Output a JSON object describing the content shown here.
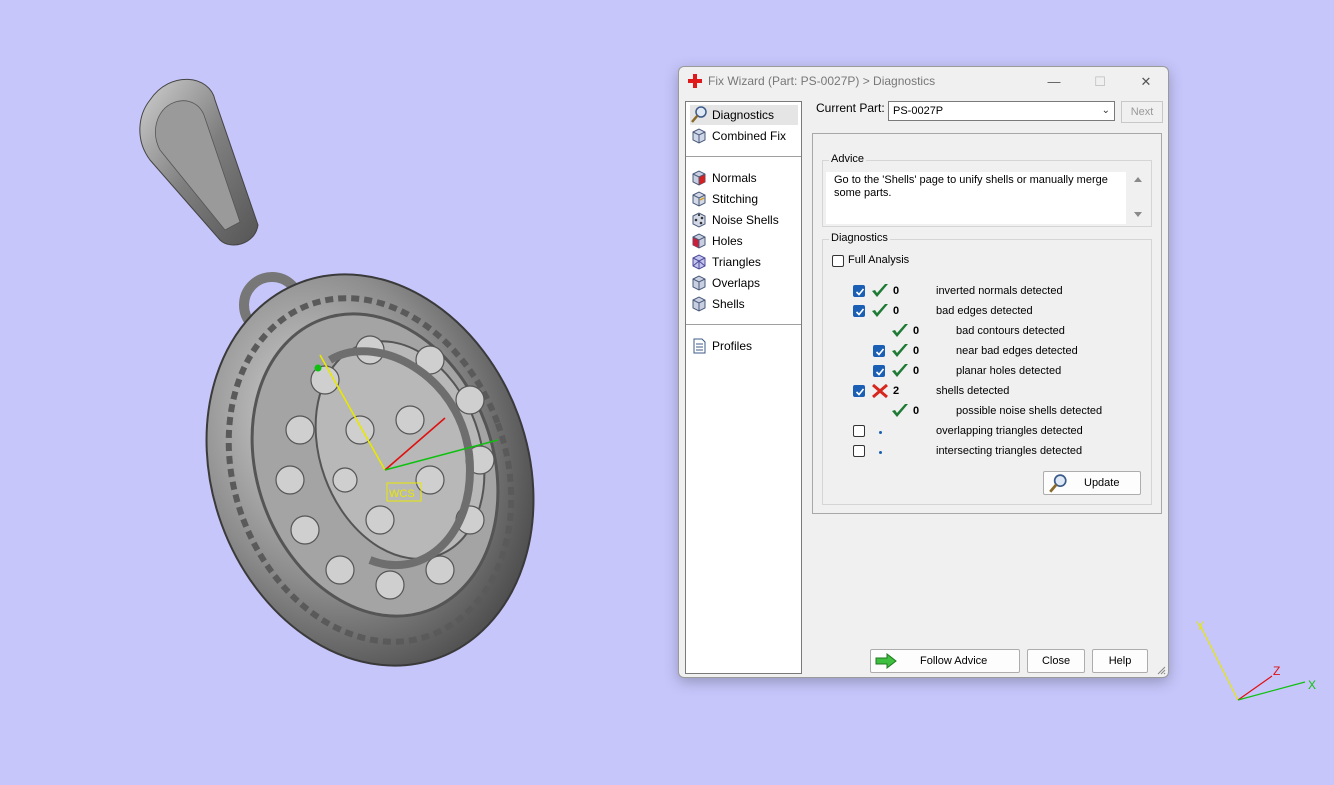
{
  "window": {
    "title": "Fix Wizard (Part: PS-0027P) > Diagnostics",
    "minimize_glyph": "—",
    "maximize_glyph": "☐",
    "close_glyph": "✕"
  },
  "nav": {
    "group1": [
      {
        "label": "Diagnostics",
        "icon": "magnifier-icon",
        "selected": true
      },
      {
        "label": "Combined Fix",
        "icon": "combined-fix-icon"
      }
    ],
    "group2": [
      {
        "label": "Normals",
        "icon": "normals-cube-icon"
      },
      {
        "label": "Stitching",
        "icon": "stitching-cube-icon"
      },
      {
        "label": "Noise Shells",
        "icon": "noise-shells-cube-icon"
      },
      {
        "label": "Holes",
        "icon": "holes-cube-icon"
      },
      {
        "label": "Triangles",
        "icon": "triangles-cube-icon"
      },
      {
        "label": "Overlaps",
        "icon": "overlaps-cube-icon"
      },
      {
        "label": "Shells",
        "icon": "shells-cube-icon"
      }
    ],
    "group3": [
      {
        "label": "Profiles",
        "icon": "profiles-document-icon"
      }
    ]
  },
  "current_part": {
    "label": "Current Part:",
    "value": "PS-0027P",
    "next_label": "Next"
  },
  "advice": {
    "title": "Advice",
    "text": "Go to the 'Shells' page to unify shells or manually merge some parts."
  },
  "diagnostics": {
    "title": "Diagnostics",
    "full_analysis_label": "Full Analysis",
    "full_analysis_checked": false,
    "rows": [
      {
        "checkbox": "checked",
        "status": "ok",
        "count": "0",
        "label": "inverted normals detected"
      },
      {
        "checkbox": "checked",
        "status": "ok",
        "count": "0",
        "label": "bad edges detected"
      },
      {
        "checkbox": "none",
        "status": "ok",
        "count": "0",
        "label": "bad contours detected"
      },
      {
        "checkbox": "checked",
        "status": "ok",
        "count": "0",
        "label": "near bad edges detected"
      },
      {
        "checkbox": "checked",
        "status": "ok",
        "count": "0",
        "label": "planar holes detected"
      },
      {
        "checkbox": "checked",
        "status": "error",
        "count": "2",
        "label": "shells detected"
      },
      {
        "checkbox": "none",
        "status": "ok",
        "count": "0",
        "label": "possible noise shells detected"
      },
      {
        "checkbox": "unchecked",
        "status": "pending",
        "count": "",
        "label": "overlapping triangles detected"
      },
      {
        "checkbox": "unchecked",
        "status": "pending",
        "count": "",
        "label": "intersecting triangles detected"
      }
    ],
    "update_label": "Update"
  },
  "buttons": {
    "follow_advice": "Follow Advice",
    "close": "Close",
    "help": "Help"
  },
  "viewport": {
    "wcs_label": "WCS",
    "axis_x": "X",
    "axis_y": "Y",
    "axis_z": "Z",
    "background": "#c6c6fb"
  },
  "colors": {
    "check_green": "#1f7a35",
    "error_red": "#d7261e",
    "checkbox_blue": "#1a5fb4"
  }
}
